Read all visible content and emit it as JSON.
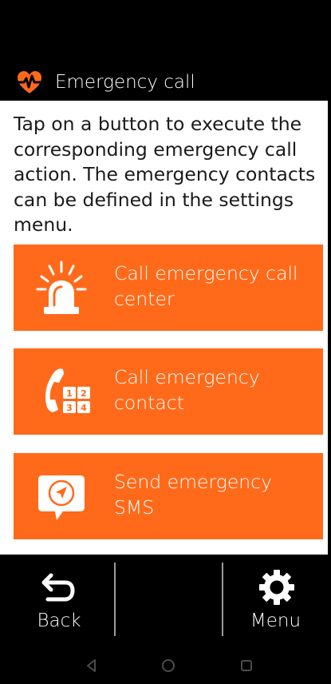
{
  "header": {
    "title": "Emergency call",
    "icon": "heart-pulse-icon",
    "accent": "#ff6a1a"
  },
  "main": {
    "instructions": "Tap on a button to execute the corresponding emergency call action. The emergency contacts can be defined in the settings menu.",
    "buttons": [
      {
        "label": "Call emergency call center",
        "icon": "siren-icon"
      },
      {
        "label": "Call emergency contact",
        "icon": "phone-keypad-icon"
      },
      {
        "label": "Send emergency SMS",
        "icon": "sms-location-icon"
      }
    ]
  },
  "bottom_bar": {
    "back_label": "Back",
    "menu_label": "Menu",
    "back_icon": "return-arrow-icon",
    "menu_icon": "gear-icon"
  },
  "nav_bar": {
    "icons": [
      "android-back-icon",
      "android-home-icon",
      "android-recents-icon"
    ]
  },
  "colors": {
    "button_background": "#ff6a1a",
    "bar_background": "#000000",
    "content_background": "#ffffff"
  }
}
